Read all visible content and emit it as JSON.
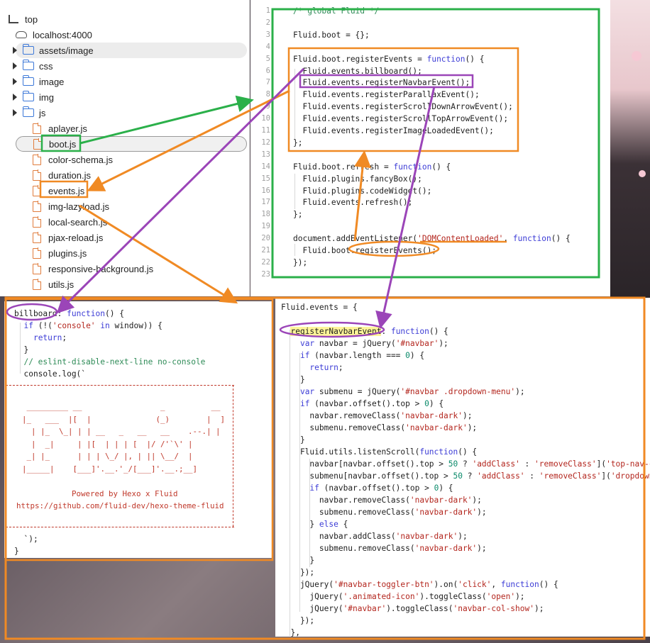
{
  "tree": {
    "items": [
      {
        "label": "top",
        "kind": "top"
      },
      {
        "label": "localhost:4000",
        "kind": "cloud"
      },
      {
        "label": "assets/image",
        "kind": "folder",
        "caret": true,
        "selected": true
      },
      {
        "label": "css",
        "kind": "folder",
        "caret": true
      },
      {
        "label": "image",
        "kind": "folder",
        "caret": true
      },
      {
        "label": "img",
        "kind": "folder",
        "caret": true
      },
      {
        "label": "js",
        "kind": "folder",
        "caret": true
      },
      {
        "label": "aplayer.js",
        "kind": "file"
      },
      {
        "label": "boot.js",
        "kind": "file",
        "selected": true
      },
      {
        "label": "color-schema.js",
        "kind": "file"
      },
      {
        "label": "duration.js",
        "kind": "file"
      },
      {
        "label": "events.js",
        "kind": "file"
      },
      {
        "label": "img-lazyload.js",
        "kind": "file"
      },
      {
        "label": "local-search.js",
        "kind": "file"
      },
      {
        "label": "pjax-reload.js",
        "kind": "file"
      },
      {
        "label": "plugins.js",
        "kind": "file"
      },
      {
        "label": "responsive-background.js",
        "kind": "file"
      },
      {
        "label": "utils.js",
        "kind": "file"
      }
    ]
  },
  "boot_code": {
    "line_numbers": [
      "1",
      "2",
      "3",
      "4",
      "5",
      "6",
      "7",
      "8",
      "9",
      "10",
      "11",
      "12",
      "13",
      "14",
      "15",
      "16",
      "17",
      "18",
      "19",
      "20",
      "21",
      "22",
      "23"
    ],
    "lines": [
      "/* global Fluid */",
      "",
      "Fluid.boot = {};",
      "",
      "Fluid.boot.registerEvents = function() {",
      "  Fluid.events.billboard();",
      "  Fluid.events.registerNavbarEvent();",
      "  Fluid.events.registerParallaxEvent();",
      "  Fluid.events.registerScrollDownArrowEvent();",
      "  Fluid.events.registerScrollTopArrowEvent();",
      "  Fluid.events.registerImageLoadedEvent();",
      "};",
      "",
      "Fluid.boot.refresh = function() {",
      "  Fluid.plugins.fancyBox();",
      "  Fluid.plugins.codeWidget();",
      "  Fluid.events.refresh();",
      "};",
      "",
      "document.addEventListener('DOMContentLoaded', function() {",
      "  Fluid.boot.registerEvents();",
      "});",
      ""
    ]
  },
  "billboard_code": {
    "lines": [
      "billboard: function() {",
      "  if (!('console' in window)) {",
      "    return;",
      "  }",
      "  // eslint-disable-next-line no-console",
      "  console.log(`"
    ],
    "ascii": [
      "   _________ __                 _          __",
      "  |_   ___  |[  |              (_)        |  ]",
      "    | |_  \\_| | | __   _   __   __    .--.| |",
      "    |  _|     | |[  | | | [  |/ /'`\\' |",
      "   _| |_      | | | \\_/ |, | || \\__/  |",
      "  |_____|    [___]'.__.'_/[___]'.__.;__]",
      "",
      "              Powered by Hexo x Fluid",
      "  https://github.com/fluid-dev/hexo-theme-fluid"
    ],
    "closing": [
      "  `);",
      "}"
    ]
  },
  "events_code": {
    "lines": [
      "Fluid.events = {",
      "",
      "  registerNavbarEvent: function() {",
      "    var navbar = jQuery('#navbar');",
      "    if (navbar.length === 0) {",
      "      return;",
      "    }",
      "    var submenu = jQuery('#navbar .dropdown-menu');",
      "    if (navbar.offset().top > 0) {",
      "      navbar.removeClass('navbar-dark');",
      "      submenu.removeClass('navbar-dark');",
      "    }",
      "    Fluid.utils.listenScroll(function() {",
      "      navbar[navbar.offset().top > 50 ? 'addClass' : 'removeClass']('top-nav-c",
      "      submenu[navbar.offset().top > 50 ? 'addClass' : 'removeClass']('dropdown",
      "      if (navbar.offset().top > 0) {",
      "        navbar.removeClass('navbar-dark');",
      "        submenu.removeClass('navbar-dark');",
      "      } else {",
      "        navbar.addClass('navbar-dark');",
      "        submenu.removeClass('navbar-dark');",
      "      }",
      "    });",
      "    jQuery('#navbar-toggler-btn').on('click', function() {",
      "      jQuery('.animated-icon').toggleClass('open');",
      "      jQuery('#navbar').toggleClass('navbar-col-show');",
      "    });",
      "  },"
    ]
  },
  "colors": {
    "green": "#2bb04a",
    "orange": "#f08a24",
    "purple": "#9b45b8"
  }
}
